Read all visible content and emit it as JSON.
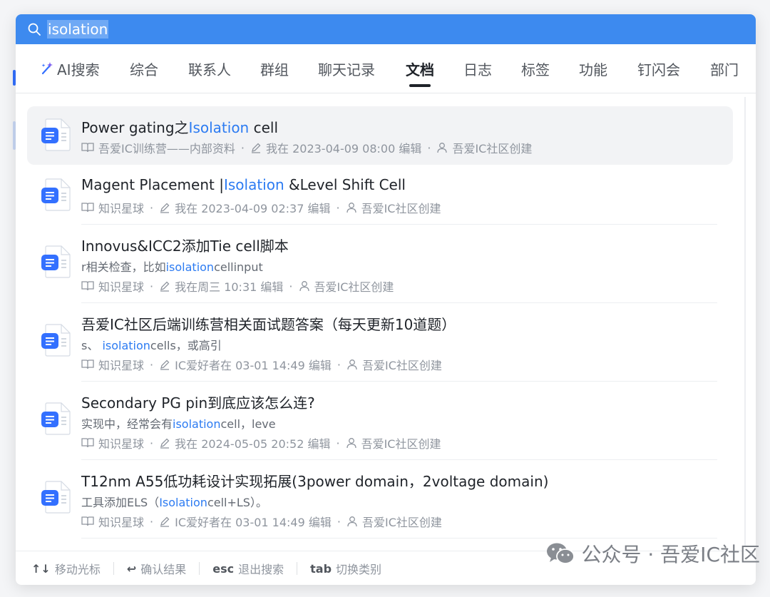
{
  "search": {
    "query": "isolation"
  },
  "tabs": [
    {
      "label": "AI搜索"
    },
    {
      "label": "综合"
    },
    {
      "label": "联系人"
    },
    {
      "label": "群组"
    },
    {
      "label": "聊天记录"
    },
    {
      "label": "文档"
    },
    {
      "label": "日志"
    },
    {
      "label": "标签"
    },
    {
      "label": "功能"
    },
    {
      "label": "钉闪会"
    },
    {
      "label": "部门"
    }
  ],
  "active_tab": "文档",
  "results": [
    {
      "title_pre": "Power gating之",
      "title_hl": "Isolation",
      "title_post": " cell",
      "meta_source": "吾爱IC训练营——内部资料",
      "meta_edit": "我在 2023-04-09 08:00 编辑",
      "meta_creator": "吾爱IC社区创建"
    },
    {
      "title_pre": "Magent Placement |",
      "title_hl": "Isolation",
      "title_post": " &Level Shift Cell",
      "meta_source": "知识星球",
      "meta_edit": "我在 2023-04-09 02:37 编辑",
      "meta_creator": "吾爱IC社区创建"
    },
    {
      "title": "Innovus&ICC2添加Tie cell脚本",
      "snippet_pre": "r相关检查，比如",
      "snippet_hl": "isolation",
      "snippet_post": "cellinput",
      "meta_source": "知识星球",
      "meta_edit": "我在周三 10:31 编辑",
      "meta_creator": "吾爱IC社区创建"
    },
    {
      "title": "吾爱IC社区后端训练营相关面试题答案（每天更新10道题）",
      "snippet_pre": "s、 ",
      "snippet_hl": "isolation",
      "snippet_post": "cells，或高引",
      "meta_source": "知识星球",
      "meta_edit": "IC爱好者在 03-01 14:49 编辑",
      "meta_creator": "吾爱IC社区创建"
    },
    {
      "title": "Secondary PG pin到底应该怎么连?",
      "snippet_pre": "实现中，经常会有",
      "snippet_hl": "isolation",
      "snippet_post": "cell，leve",
      "meta_source": "知识星球",
      "meta_edit": "我在 2024-05-05 20:52 编辑",
      "meta_creator": "吾爱IC社区创建"
    },
    {
      "title": "T12nm A55低功耗设计实现拓展(3power domain，2voltage domain)",
      "snippet_pre": "工具添加ELS（",
      "snippet_hl": "Isolation",
      "snippet_post": "cell+LS）。",
      "meta_source": "知识星球",
      "meta_edit": "IC爱好者在 03-01 14:49 编辑",
      "meta_creator": "吾爱IC社区创建"
    }
  ],
  "footer": {
    "move": {
      "key": "↑↓",
      "label": "移动光标"
    },
    "confirm": {
      "key": "↩",
      "label": "确认结果"
    },
    "exit": {
      "key": "esc",
      "label": "退出搜索"
    },
    "switch": {
      "key": "tab",
      "label": "切换类别"
    }
  },
  "watermark": "公众号 · 吾爱IC社区",
  "colors": {
    "search_bar": "#3d8aef",
    "highlight": "#2c7bf2",
    "doc_icon": "#3370ff",
    "selected_row": "#f2f3f5"
  },
  "meta_separator": "·"
}
